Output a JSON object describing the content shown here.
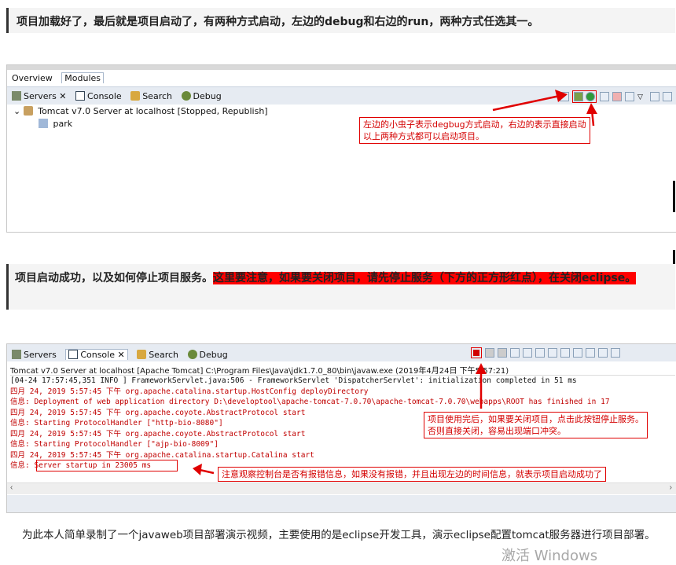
{
  "intro_text": "项目加载好了，最后就是项目启动了，有两种方式启动，左边的debug和右边的run，两种方式任选其一。",
  "shot1": {
    "top_tabs": [
      "Overview",
      "Modules"
    ],
    "view_tabs": [
      "Servers",
      "Console",
      "Search",
      "Debug"
    ],
    "server_label": "Tomcat v7.0 Server at localhost  [Stopped, Republish]",
    "child_label": "park",
    "callout_lines": [
      "左边的小虫子表示degbug方式启动，右边的表示直接启动",
      "以上两种方式都可以启动项目。"
    ]
  },
  "mid_text": {
    "normal": "项目启动成功，以及如何停止项目服务。",
    "highlight": "这里要注意，如果要关闭项目，请先停止服务（下方的正方形红点），在关闭eclipse。"
  },
  "shot2": {
    "view_tabs": [
      "Servers",
      "Console",
      "Search",
      "Debug"
    ],
    "console_title": "Tomcat v7.0 Server at localhost [Apache Tomcat] C:\\Program Files\\Java\\jdk1.7.0_80\\bin\\javaw.exe (2019年4月24日 下午5:57:21)",
    "log_lines": [
      {
        "color": "black",
        "text": "[04-24 17:57:45,351 INFO ] FrameworkServlet.java:506 - FrameworkServlet 'DispatcherServlet': initialization completed in 51 ms"
      },
      {
        "color": "red",
        "text": "四月 24, 2019 5:57:45 下午 org.apache.catalina.startup.HostConfig deployDirectory"
      },
      {
        "color": "red",
        "text": "信息: Deployment of web application directory D:\\developtool\\apache-tomcat-7.0.70\\apache-tomcat-7.0.70\\webapps\\ROOT has finished in 17"
      },
      {
        "color": "red",
        "text": "四月 24, 2019 5:57:45 下午 org.apache.coyote.AbstractProtocol start"
      },
      {
        "color": "red",
        "text": "信息: Starting ProtocolHandler [\"http-bio-8080\"]"
      },
      {
        "color": "red",
        "text": "四月 24, 2019 5:57:45 下午 org.apache.coyote.AbstractProtocol start"
      },
      {
        "color": "red",
        "text": "信息: Starting ProtocolHandler [\"ajp-bio-8009\"]"
      },
      {
        "color": "red",
        "text": "四月 24, 2019 5:57:45 下午 org.apache.catalina.startup.Catalina start"
      },
      {
        "color": "red",
        "text": "信息: Server startup in 23005 ms"
      }
    ],
    "callout_stop": [
      "项目使用完后，如果要关闭项目，点击此按钮停止服务。",
      "否则直接关闭，容易出现端口冲突。"
    ],
    "callout_log": "注意观察控制台是否有报错信息，如果没有报错，并且出现左边的时间信息，就表示项目启动成功了"
  },
  "footer_text": "为此本人简单录制了一个javaweb项目部署演示视频，主要使用的是eclipse开发工具，演示eclipse配置tomcat服务器进行项目部署。",
  "watermark": "激活 Windows",
  "colors": {
    "accent_red": "#e00000",
    "log_red": "#c00000",
    "highlight": "#ff0000"
  }
}
